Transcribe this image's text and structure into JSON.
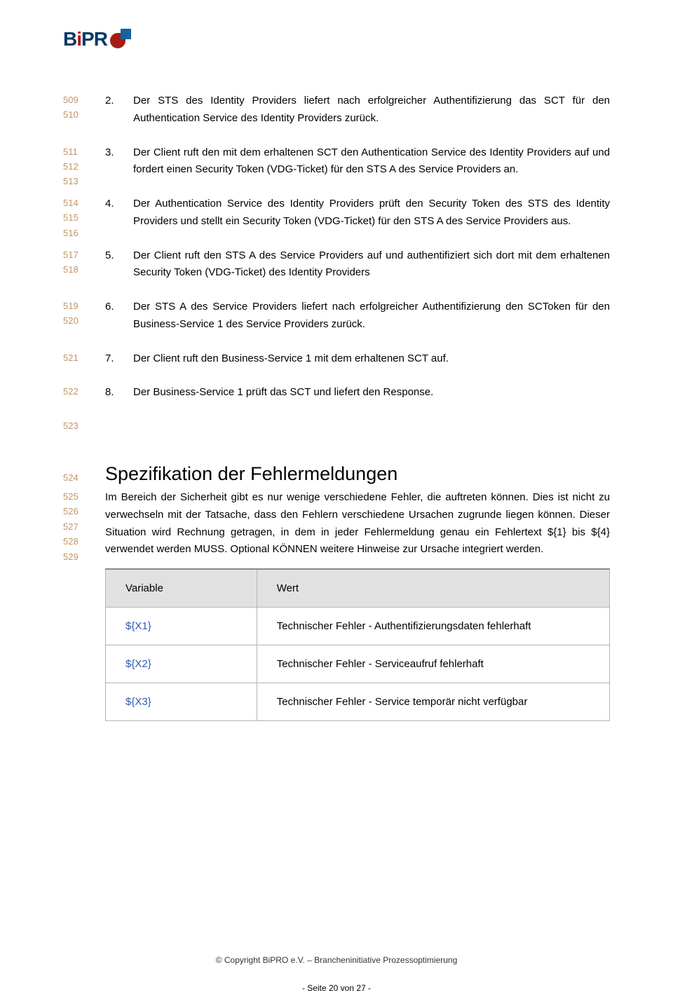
{
  "logo": {
    "text_a": "B",
    "text_b": "i",
    "text_c": "PR"
  },
  "list_start_lines": {
    "i2": [
      "509",
      "510"
    ],
    "i3": [
      "511",
      "512",
      "513"
    ],
    "i4": [
      "514",
      "515",
      "516"
    ],
    "i5": [
      "517",
      "518"
    ],
    "i6": [
      "519",
      "520"
    ],
    "i7": [
      "521"
    ],
    "i8": [
      "522"
    ]
  },
  "items": {
    "i2": {
      "n": "2.",
      "t": "Der STS des Identity Providers liefert nach erfolgreicher Authentifizierung das SCT für den Authentication Service des Identity Providers zurück."
    },
    "i3": {
      "n": "3.",
      "t": "Der Client ruft den mit dem erhaltenen SCT den Authentication Service des Identity Providers auf und fordert einen Security Token (VDG-Ticket) für den STS A des Service Providers an."
    },
    "i4": {
      "n": "4.",
      "t": "Der Authentication Service des Identity Providers prüft den Security Token des STS des Identity Providers und stellt ein Security Token (VDG-Ticket) für den STS A des Service Providers aus."
    },
    "i5": {
      "n": "5.",
      "t": "Der Client ruft den STS A des Service Providers auf und authentifiziert sich dort mit dem erhaltenen Security Token (VDG-Ticket) des Identity Providers"
    },
    "i6": {
      "n": "6.",
      "t": "Der STS A des Service Providers liefert nach erfolgreicher Authentifizierung den SCToken für den Business-Service 1 des Service Providers zurück."
    },
    "i7": {
      "n": "7.",
      "t": "Der Client ruft den Business-Service 1 mit dem erhaltenen SCT auf."
    },
    "i8": {
      "n": "8.",
      "t": "Der Business-Service 1 prüft das SCT und liefert den Response."
    }
  },
  "blank_line": "523",
  "heading_line": "524",
  "heading": "Spezifikation der Fehlermeldungen",
  "para_lines": [
    "525",
    "526",
    "527",
    "528",
    "529"
  ],
  "para": "Im Bereich der Sicherheit gibt es nur wenige verschiedene Fehler, die auftreten können. Dies ist nicht zu verwechseln mit der Tatsache, dass den Fehlern verschiedene Ursachen zugrunde liegen können. Dieser Situation wird Rechnung getragen, in dem in jeder Fehlermeldung genau ein Fehlertext ${1} bis ${4} verwendet werden MUSS. Optional KÖNNEN weitere Hinweise zur Ursache integriert werden.",
  "table": {
    "h1": "Variable",
    "h2": "Wert",
    "rows": [
      {
        "v": "${X1}",
        "w": "Technischer Fehler - Authentifizierungsdaten fehlerhaft"
      },
      {
        "v": "${X2}",
        "w": "Technischer Fehler - Serviceaufruf fehlerhaft"
      },
      {
        "v": "${X3}",
        "w": "Technischer Fehler - Service temporär nicht verfügbar"
      }
    ]
  },
  "footer": "© Copyright BiPRO e.V. – Brancheninitiative Prozessoptimierung",
  "pagenum": "- Seite 20 von 27 -"
}
